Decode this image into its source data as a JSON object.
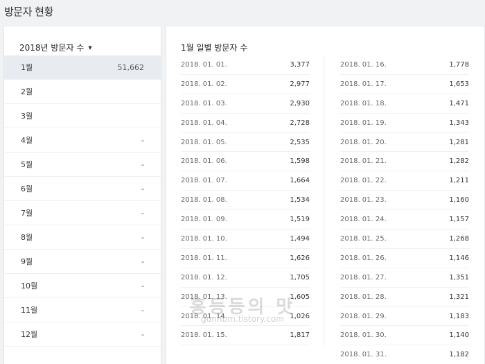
{
  "page_title": "방문자 현황",
  "year_selector": {
    "label": "2018년 방문자 수"
  },
  "months": [
    {
      "label": "1월",
      "value": "51,662",
      "active": true
    },
    {
      "label": "2월",
      "value": ""
    },
    {
      "label": "3월",
      "value": ""
    },
    {
      "label": "4월",
      "value": "-"
    },
    {
      "label": "5월",
      "value": "-"
    },
    {
      "label": "6월",
      "value": "-"
    },
    {
      "label": "7월",
      "value": "-"
    },
    {
      "label": "8월",
      "value": "-"
    },
    {
      "label": "9월",
      "value": "-"
    },
    {
      "label": "10월",
      "value": "-"
    },
    {
      "label": "11월",
      "value": "-"
    },
    {
      "label": "12월",
      "value": "-"
    }
  ],
  "daily": {
    "title": "1월 일별 방문자 수",
    "left": [
      {
        "date": "2018. 01. 01.",
        "count": "3,377"
      },
      {
        "date": "2018. 01. 02.",
        "count": "2,977"
      },
      {
        "date": "2018. 01. 03.",
        "count": "2,930"
      },
      {
        "date": "2018. 01. 04.",
        "count": "2,728"
      },
      {
        "date": "2018. 01. 05.",
        "count": "2,535"
      },
      {
        "date": "2018. 01. 06.",
        "count": "1,598"
      },
      {
        "date": "2018. 01. 07.",
        "count": "1,664"
      },
      {
        "date": "2018. 01. 08.",
        "count": "1,534"
      },
      {
        "date": "2018. 01. 09.",
        "count": "1,519"
      },
      {
        "date": "2018. 01. 10.",
        "count": "1,494"
      },
      {
        "date": "2018. 01. 11.",
        "count": "1,626"
      },
      {
        "date": "2018. 01. 12.",
        "count": "1,705"
      },
      {
        "date": "2018. 01. 13.",
        "count": "1,605"
      },
      {
        "date": "2018. 01. 14.",
        "count": "1,026"
      },
      {
        "date": "2018. 01. 15.",
        "count": "1,817"
      }
    ],
    "right": [
      {
        "date": "2018. 01. 16.",
        "count": "1,778"
      },
      {
        "date": "2018. 01. 17.",
        "count": "1,653"
      },
      {
        "date": "2018. 01. 18.",
        "count": "1,471"
      },
      {
        "date": "2018. 01. 19.",
        "count": "1,343"
      },
      {
        "date": "2018. 01. 20.",
        "count": "1,281"
      },
      {
        "date": "2018. 01. 21.",
        "count": "1,282"
      },
      {
        "date": "2018. 01. 22.",
        "count": "1,211"
      },
      {
        "date": "2018. 01. 23.",
        "count": "1,160"
      },
      {
        "date": "2018. 01. 24.",
        "count": "1,157"
      },
      {
        "date": "2018. 01. 25.",
        "count": "1,268"
      },
      {
        "date": "2018. 01. 26.",
        "count": "1,146"
      },
      {
        "date": "2018. 01. 27.",
        "count": "1,351"
      },
      {
        "date": "2018. 01. 28.",
        "count": "1,321"
      },
      {
        "date": "2018. 01. 29.",
        "count": "1,183"
      },
      {
        "date": "2018. 01. 30.",
        "count": "1,140"
      },
      {
        "date": "2018. 01. 31.",
        "count": "1,182"
      }
    ]
  },
  "watermark": {
    "title": "홍등등의 맛",
    "url": "gunhbm.tistory.com"
  }
}
